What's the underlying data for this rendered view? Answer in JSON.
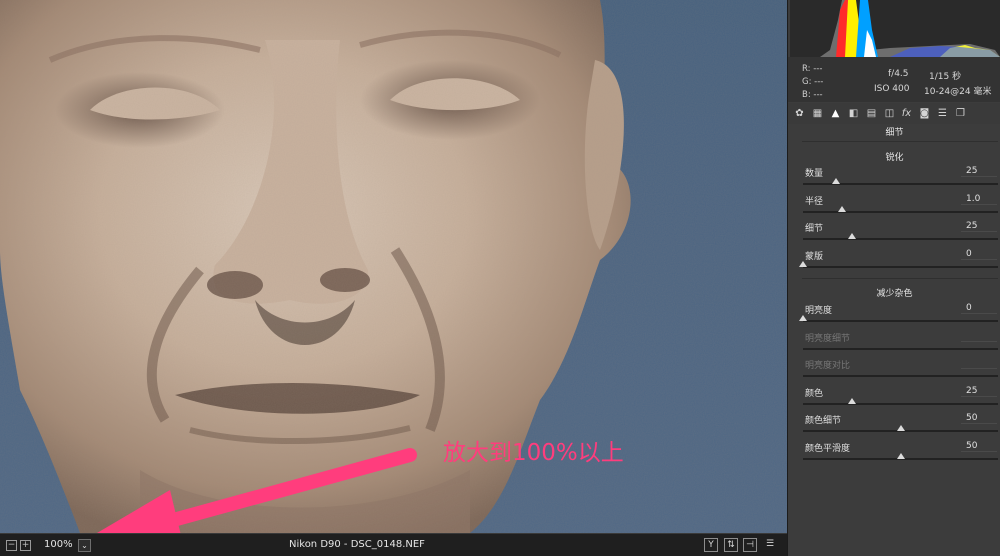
{
  "status_bar": {
    "zoom_out_icon": "−",
    "zoom_in_icon": "+",
    "zoom_value": "100%",
    "zoom_dropdown_icon": "⌄",
    "camera_file": "Nikon D90 - DSC_0148.NEF",
    "compare_label": "Y",
    "swap_icon": "⇅",
    "copy_icon": "⊣",
    "settings_icon": "☰"
  },
  "readout": {
    "r": "R:   ---",
    "g": "G:   ---",
    "b": "B:   ---",
    "aperture": "f/4.5",
    "shutter": "1/15 秒",
    "iso": "ISO 400",
    "lens": "10-24@24 毫米"
  },
  "panel": {
    "title": "细节",
    "sharpen_title": "锐化",
    "sharpen": [
      {
        "label": "数量",
        "value": "25",
        "level": 0.17
      },
      {
        "label": "半径",
        "value": "1.0",
        "level": 0.2
      },
      {
        "label": "细节",
        "value": "25",
        "level": 0.25
      },
      {
        "label": "蒙版",
        "value": "0",
        "level": 0.0
      }
    ],
    "noise_title": "减少杂色",
    "noise": [
      {
        "label": "明亮度",
        "value": "0",
        "level": 0.0,
        "dim": false
      },
      {
        "label": "明亮度细节",
        "value": "",
        "level": null,
        "dim": true
      },
      {
        "label": "明亮度对比",
        "value": "",
        "level": null,
        "dim": true
      },
      {
        "label": "颜色",
        "value": "25",
        "level": 0.25,
        "dim": false
      },
      {
        "label": "颜色细节",
        "value": "50",
        "level": 0.5,
        "dim": false
      },
      {
        "label": "颜色平滑度",
        "value": "50",
        "level": 0.5,
        "dim": false
      }
    ]
  },
  "tools": [
    "aperture-icon",
    "grid-icon",
    "mountain-icon",
    "split-icon",
    "hsl-icon",
    "lens-icon",
    "fx-icon",
    "camera-icon",
    "sliders-icon",
    "presets-icon"
  ],
  "annotation": {
    "text": "放大到100%以上",
    "color": "#ff3d7d"
  }
}
